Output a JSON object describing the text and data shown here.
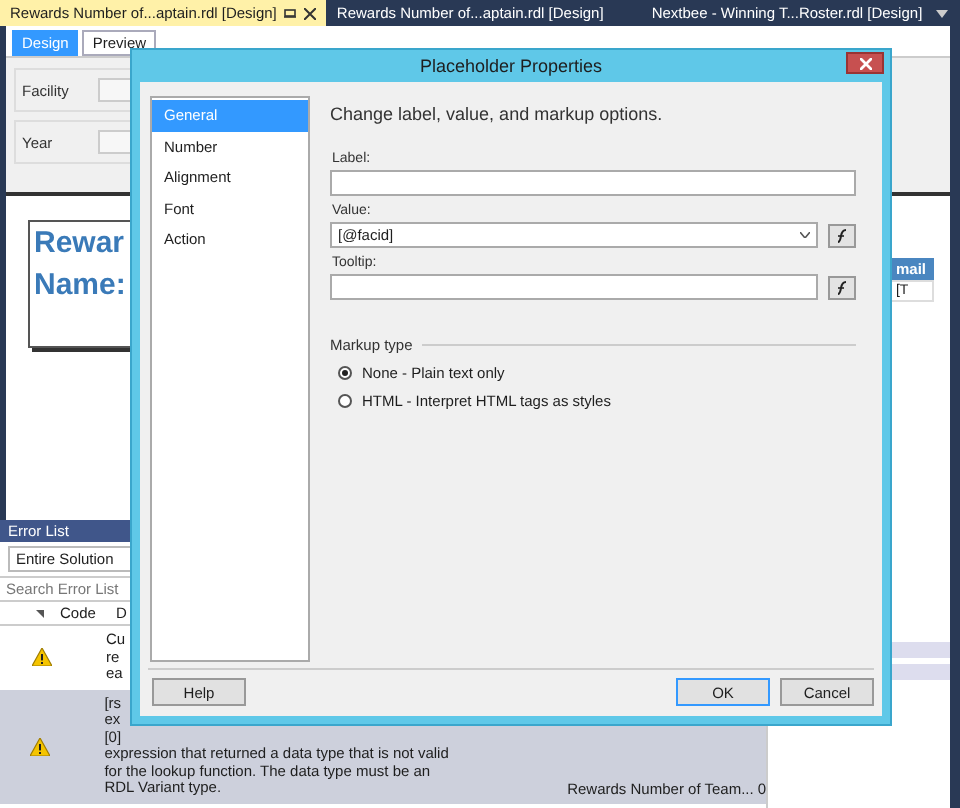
{
  "document_tabs": [
    {
      "label": "Rewards Number of...aptain.rdl [Design]",
      "selected": true
    },
    {
      "label": "Rewards Number of...aptain.rdl [Design]",
      "selected": false
    },
    {
      "label": "Nextbee - Winning T...Roster.rdl [Design]",
      "selected": false
    }
  ],
  "view_tabs": [
    {
      "label": "Design",
      "selected": true
    },
    {
      "label": "Preview",
      "selected": false
    }
  ],
  "parameters": [
    {
      "label": "Facility"
    },
    {
      "label": "Year"
    }
  ],
  "report": {
    "title_lines": [
      "Rewar",
      "Name:"
    ],
    "column_header": "mail",
    "cell": "[T"
  },
  "error_list": {
    "title": "Error List",
    "scope": "Entire Solution",
    "search_placeholder": "Search Error List",
    "columns": [
      "Code",
      "D"
    ],
    "rows": [
      {
        "selected": false,
        "description_lines": [
          "Cu",
          "re",
          "ea"
        ]
      },
      {
        "selected": true,
        "description_lines": [
          "[rs",
          "ex",
          "[0]",
          "expression that returned a data type that is not valid",
          "for the lookup function. The data type must be an",
          "RDL Variant type."
        ],
        "file": "Rewards Number of Team...",
        "line": "0"
      }
    ]
  },
  "dialog": {
    "title": "Placeholder Properties",
    "pages": [
      {
        "label": "General",
        "selected": true
      },
      {
        "label": "Number",
        "selected": false
      },
      {
        "label": "Alignment",
        "selected": false
      },
      {
        "label": "Font",
        "selected": false
      },
      {
        "label": "Action",
        "selected": false
      }
    ],
    "heading": "Change label, value, and markup options.",
    "fields": [
      {
        "label": "Label:",
        "dropdown": false,
        "expression_button": false
      },
      {
        "label": "Value:",
        "value": "[@facid]",
        "dropdown": true,
        "expression_button": true
      },
      {
        "label": "Tooltip:",
        "dropdown": false,
        "expression_button": true
      }
    ],
    "markup": {
      "title": "Markup type",
      "options": [
        {
          "label": "None - Plain text only",
          "selected": true
        },
        {
          "label": "HTML - Interpret HTML tags as styles",
          "selected": false
        }
      ]
    },
    "buttons": {
      "help": "Help",
      "ok": "OK",
      "cancel": "Cancel"
    }
  }
}
